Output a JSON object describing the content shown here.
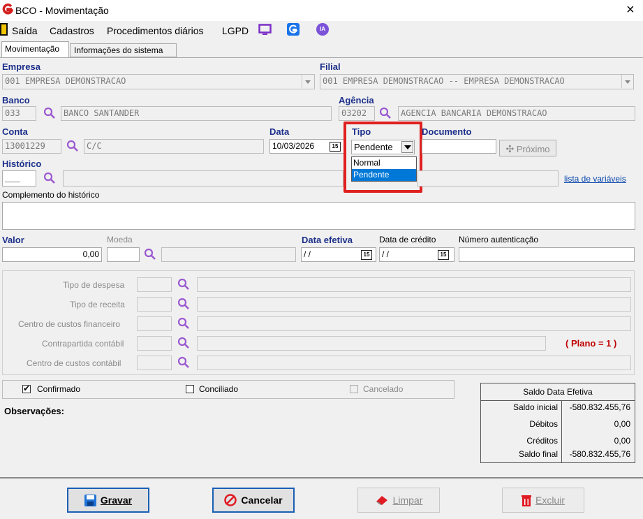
{
  "window": {
    "title": "BCO - Movimentação",
    "close_glyph": "×"
  },
  "menu": {
    "items": [
      "Saída",
      "Cadastros",
      "Procedimentos diários",
      "LGPD"
    ],
    "ia_label": "IA"
  },
  "tabs": [
    "Movimentação",
    "Informações do sistema"
  ],
  "empresa": {
    "label": "Empresa",
    "value": "001 EMPRESA DEMONSTRACAO"
  },
  "filial": {
    "label": "Filial",
    "value": "001 EMPRESA DEMONSTRACAO -- EMPRESA DEMONSTRACAO"
  },
  "banco": {
    "label": "Banco",
    "code": "033",
    "name": "BANCO SANTANDER"
  },
  "agencia": {
    "label": "Agência",
    "code": "03202",
    "name": "AGENCIA BANCARIA DEMONSTRACAO"
  },
  "conta": {
    "label": "Conta",
    "code": "13001229",
    "desc": "C/C"
  },
  "data": {
    "label": "Data",
    "value": "10/03/2026"
  },
  "tipo": {
    "label": "Tipo",
    "value": "Pendente",
    "options": [
      "Normal",
      "Pendente"
    ],
    "selected": "Pendente",
    "highlight_color": "#e02020"
  },
  "documento": {
    "label": "Documento",
    "proximo_label": "Próximo"
  },
  "historico": {
    "label": "Histórico",
    "code": "___",
    "link": "lista de variáveis"
  },
  "complemento": {
    "label": "Complemento do histórico"
  },
  "valor": {
    "label": "Valor",
    "value": "0,00"
  },
  "moeda": {
    "label": "Moeda"
  },
  "data_efetiva": {
    "label": "Data efetiva",
    "value": "/ /"
  },
  "data_credito": {
    "label": "Data de crédito",
    "value": "/ /"
  },
  "numero_autenticacao": {
    "label": "Número autenticação"
  },
  "classificacao": {
    "rows": [
      "Tipo de despesa",
      "Tipo de receita",
      "Centro de custos financeiro",
      "Contrapartida contábil",
      "Centro de custos contábil"
    ],
    "plano": "( Plano = 1 )"
  },
  "status": {
    "confirmado": "Confirmado",
    "conciliado": "Conciliado",
    "cancelado": "Cancelado"
  },
  "observacoes": {
    "label": "Observações:"
  },
  "saldo": {
    "title": "Saldo Data Efetiva",
    "rows": [
      {
        "label": "Saldo inicial",
        "value": "-580.832.455,76"
      },
      {
        "label": "Débitos",
        "value": "0,00"
      },
      {
        "label": "Créditos",
        "value": "0,00"
      },
      {
        "label": "Saldo final",
        "value": "-580.832.455,76"
      }
    ]
  },
  "buttons": {
    "gravar": "Gravar",
    "cancelar": "Cancelar",
    "limpar": "Limpar",
    "excluir": "Excluir"
  }
}
